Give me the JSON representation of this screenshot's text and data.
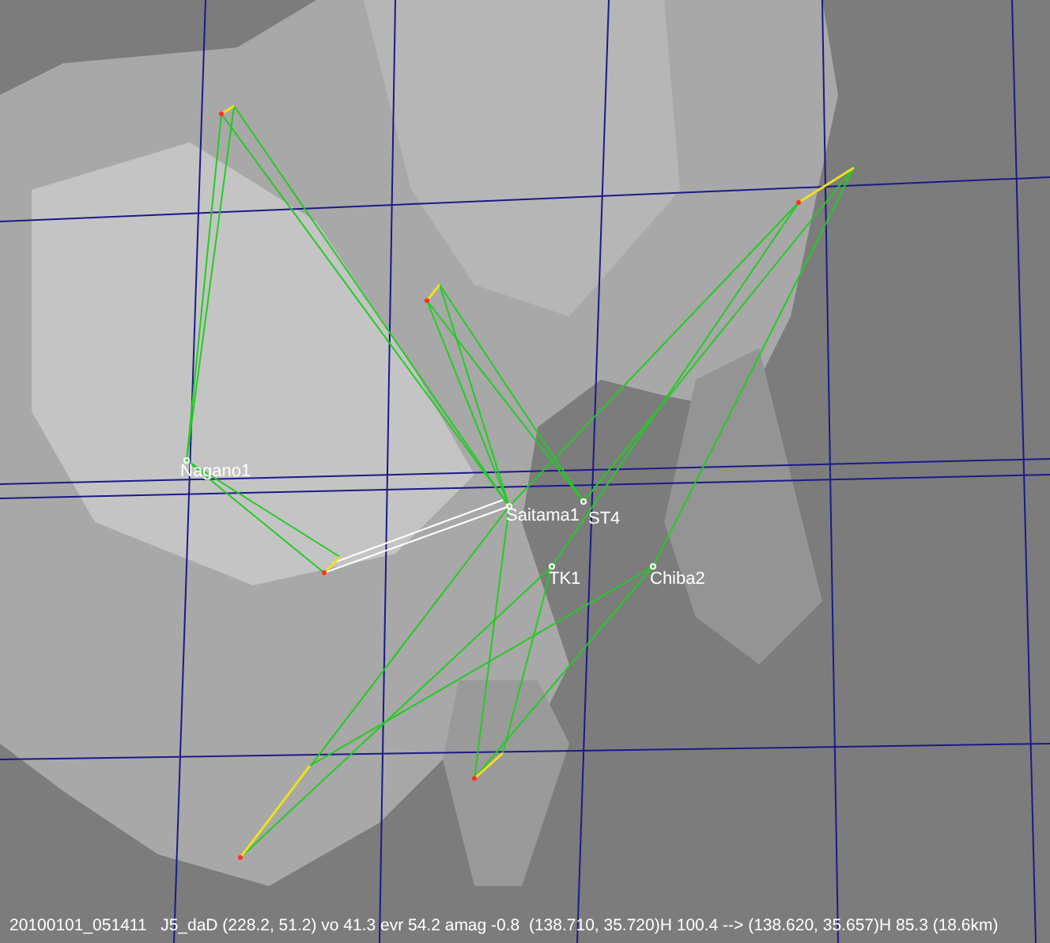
{
  "map": {
    "stations": [
      {
        "name": "Nagano1"
      },
      {
        "name": "Saitama1"
      },
      {
        "name": "ST4"
      },
      {
        "name": "TK1"
      },
      {
        "name": "Chiba2"
      }
    ]
  },
  "status_bar": {
    "text": "20100101_051411   J5_daD (228.2, 51.2) vo 41.3 evr 54.2 amag -0.8  (138.710, 35.720)H 100.4 --> (138.620, 35.657)H 85.3 (18.6km)"
  }
}
